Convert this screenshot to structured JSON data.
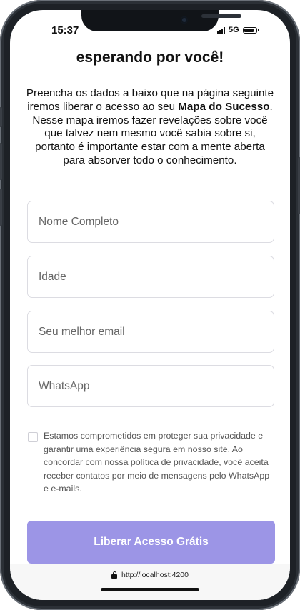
{
  "status_bar": {
    "time": "15:37",
    "network": "5G",
    "battery_level": 0.85
  },
  "page": {
    "heading": "esperando por você!",
    "intro_part1": "Preencha os dados a baixo que na página seguinte iremos liberar o acesso ao seu ",
    "intro_bold": "Mapa do Sucesso",
    "intro_part2": ". Nesse mapa iremos fazer revelações sobre você que talvez nem mesmo você sabia sobre si, portanto é importante estar com a mente aberta para absorver todo o conhecimento."
  },
  "form": {
    "name_placeholder": "Nome Completo",
    "age_placeholder": "Idade",
    "email_placeholder": "Seu melhor email",
    "whatsapp_placeholder": "WhatsApp",
    "consent_checked": false,
    "consent_text": "Estamos comprometidos em proteger sua privacidade e garantir uma experiência segura em nosso site. Ao concordar com nossa política de privacidade, você aceita receber contatos por meio de mensagens pelo WhatsApp e e-mails.",
    "submit_label": "Liberar Acesso Grátis"
  },
  "browser": {
    "url": "http://localhost:4200"
  },
  "colors": {
    "accent": "#9c95e6",
    "text": "#111111",
    "border": "#dcdce2"
  }
}
